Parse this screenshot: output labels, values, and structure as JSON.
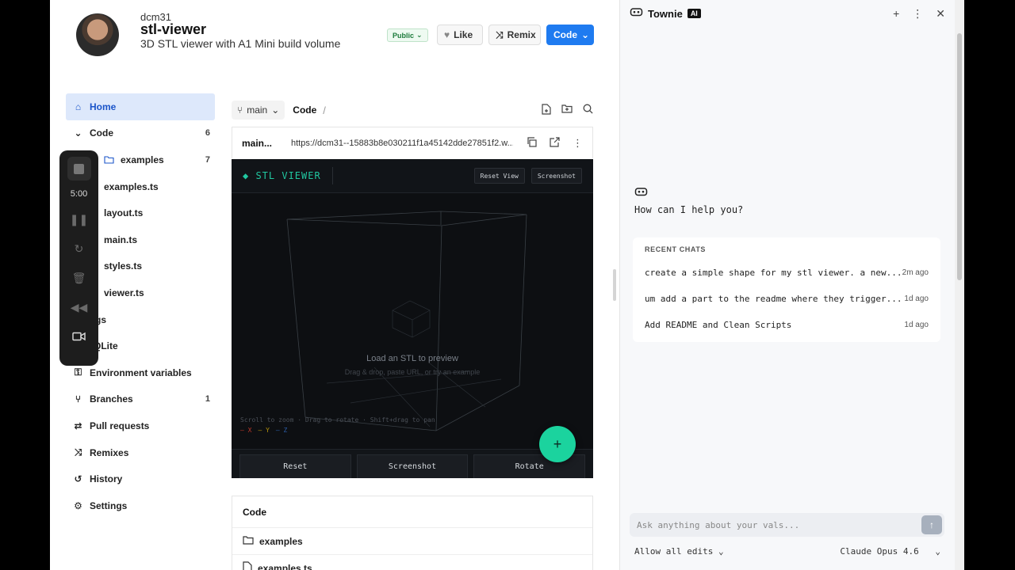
{
  "header": {
    "owner": "dcm31",
    "title": "stl-viewer",
    "subtitle": "3D STL viewer with A1 Mini build volume",
    "visibility": "Public",
    "like_label": "Like",
    "remix_label": "Remix",
    "code_label": "Code"
  },
  "sidebar": {
    "items": [
      {
        "label": "Home",
        "icon": "home-icon",
        "active": true,
        "count": ""
      },
      {
        "label": "Code",
        "icon": "chevron-down-icon",
        "count": "6"
      },
      {
        "label": "examples",
        "icon": "folder-icon",
        "count": "7"
      },
      {
        "label": "examples.ts",
        "icon": "file-icon",
        "count": ""
      },
      {
        "label": "layout.ts",
        "icon": "file-icon",
        "count": ""
      },
      {
        "label": "main.ts",
        "icon": "file-icon",
        "count": ""
      },
      {
        "label": "styles.ts",
        "icon": "file-icon",
        "count": ""
      },
      {
        "label": "viewer.ts",
        "icon": "file-icon",
        "count": ""
      },
      {
        "label": "gs",
        "icon": "",
        "count": ""
      },
      {
        "label": "QLite",
        "icon": "",
        "count": ""
      },
      {
        "label": "Environment variables",
        "icon": "key-icon",
        "count": ""
      },
      {
        "label": "Branches",
        "icon": "branch-icon",
        "count": "1"
      },
      {
        "label": "Pull requests",
        "icon": "pull-request-icon",
        "count": ""
      },
      {
        "label": "Remixes",
        "icon": "shuffle-icon",
        "count": ""
      },
      {
        "label": "History",
        "icon": "history-icon",
        "count": ""
      },
      {
        "label": "Settings",
        "icon": "gear-icon",
        "count": ""
      }
    ]
  },
  "recorder": {
    "time": "5:00"
  },
  "toolbar": {
    "branch": "main",
    "crumb": "Code",
    "sep": "/"
  },
  "urlbar": {
    "file": "main...",
    "url": "https://dcm31--15883b8e030211f1a45142dde27851f2.w..."
  },
  "preview": {
    "title": "◆ STL VIEWER",
    "reset_view": "Reset View",
    "screenshot": "Screenshot",
    "load_title": "Load an STL to preview",
    "load_sub": "Drag & drop, paste URL, or try an example",
    "hint": "Scroll to zoom · Drag to rotate · Shift+drag to pan",
    "axes": [
      {
        "label": "— X",
        "color": "#c0392b"
      },
      {
        "label": "— Y",
        "color": "#b7950b"
      },
      {
        "label": "— Z",
        "color": "#2c5ea8"
      }
    ],
    "bottom": [
      "Reset",
      "Screenshot",
      "Rotate"
    ],
    "fab": "+"
  },
  "code_list": {
    "title": "Code",
    "rows": [
      {
        "label": "examples",
        "icon": "folder-icon"
      },
      {
        "label": "examples.ts",
        "icon": "file-icon"
      }
    ]
  },
  "townie": {
    "title": "Townie",
    "badge": "AI",
    "help": "How can I help you?",
    "recent_header": "RECENT CHATS",
    "chats": [
      {
        "text": "create a simple shape for my stl viewer. a new...",
        "time": "2m ago"
      },
      {
        "text": "um add a part to the readme where they trigger...",
        "time": "1d ago"
      },
      {
        "text": "Add README and Clean Scripts",
        "time": "1d ago"
      }
    ],
    "ask_placeholder": "Ask anything about your vals...",
    "allow_edits": "Allow all edits",
    "model": "Claude Opus 4.6"
  },
  "colors": {
    "accent": "#1f7bf0",
    "teal": "#21c7a0",
    "fab": "#1bd39e"
  }
}
